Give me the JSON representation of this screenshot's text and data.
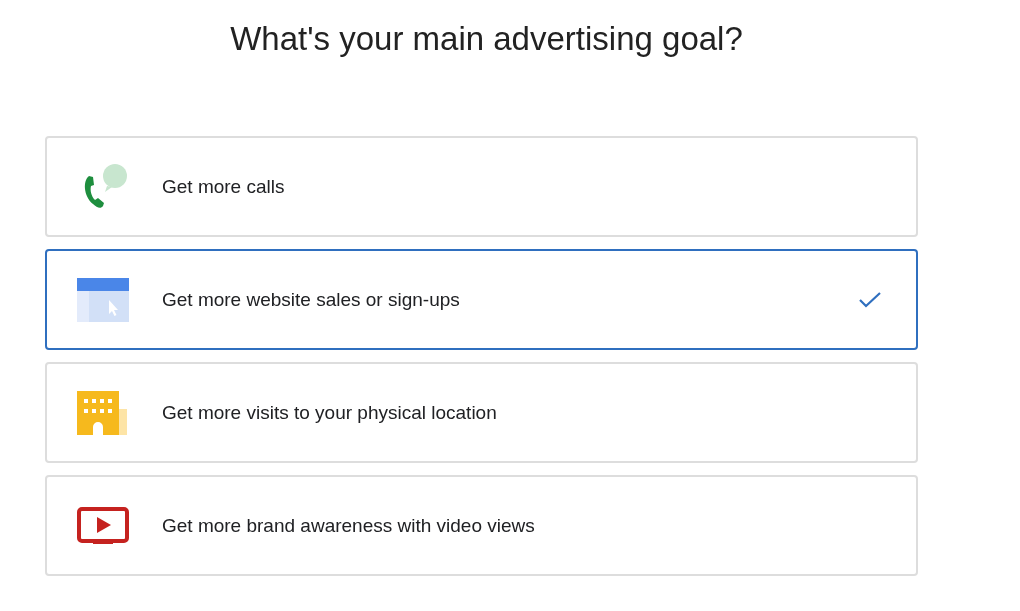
{
  "title": "What's your main advertising goal?",
  "options": [
    {
      "kind": "calls",
      "label": "Get more calls",
      "selected": false
    },
    {
      "kind": "website",
      "label": "Get more website sales or sign-ups",
      "selected": true
    },
    {
      "kind": "visits",
      "label": "Get more visits to your physical location",
      "selected": false
    },
    {
      "kind": "video",
      "label": "Get more brand awareness with video views",
      "selected": false
    }
  ]
}
